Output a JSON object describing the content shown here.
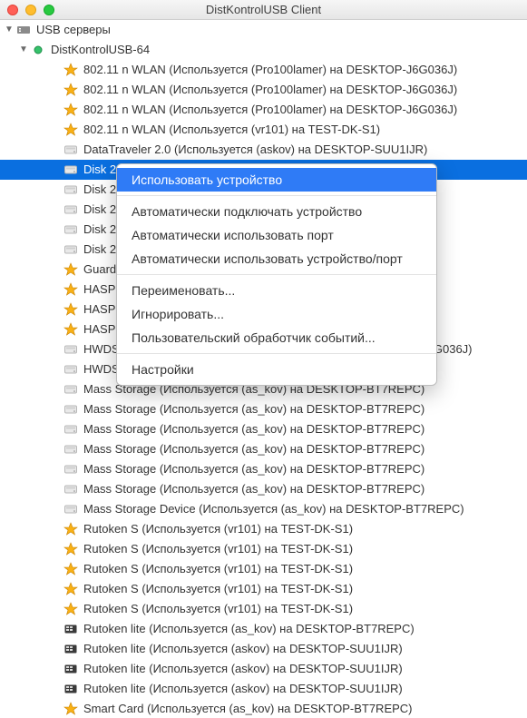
{
  "window": {
    "title": "DistKontrolUSB Client"
  },
  "tree": [
    {
      "depth": 0,
      "icon": "usb",
      "arrow": "down",
      "label": "USB серверы"
    },
    {
      "depth": 1,
      "icon": "dot-green",
      "arrow": "down",
      "label": "DistKontrolUSB-64"
    },
    {
      "depth": 2,
      "icon": "star",
      "label": "802.11 n WLAN (Используется  (Pro100lamer) на DESKTOP-J6G036J)"
    },
    {
      "depth": 2,
      "icon": "star",
      "label": "802.11 n WLAN (Используется  (Pro100lamer) на DESKTOP-J6G036J)"
    },
    {
      "depth": 2,
      "icon": "star",
      "label": "802.11 n WLAN (Используется  (Pro100lamer) на DESKTOP-J6G036J)"
    },
    {
      "depth": 2,
      "icon": "star",
      "label": "802.11 n WLAN (Используется  (vr101) на TEST-DK-S1)"
    },
    {
      "depth": 2,
      "icon": "drive",
      "label": "DataTraveler 2.0 (Используется  (askov) на DESKTOP-SUU1IJR)"
    },
    {
      "depth": 2,
      "icon": "drive",
      "label": "Disk 2.0",
      "selected": true
    },
    {
      "depth": 2,
      "icon": "drive",
      "label": "Disk 2.0"
    },
    {
      "depth": 2,
      "icon": "drive",
      "label": "Disk 2.0"
    },
    {
      "depth": 2,
      "icon": "drive",
      "label": "Disk 2.0"
    },
    {
      "depth": 2,
      "icon": "drive",
      "label": "Disk 2.0"
    },
    {
      "depth": 2,
      "icon": "star",
      "label": "Guarda                                                               EPC)"
    },
    {
      "depth": 2,
      "icon": "star",
      "label": "HASP 2                                                               .)"
    },
    {
      "depth": 2,
      "icon": "star",
      "label": "HASP 2"
    },
    {
      "depth": 2,
      "icon": "star",
      "label": "HASP H"
    },
    {
      "depth": 2,
      "icon": "drive",
      "label": "HWDSSL DEVICE (Используется  (Pro100lamer) на DESKTOP-J6G036J)"
    },
    {
      "depth": 2,
      "icon": "drive",
      "label": "HWDSSL DEVICE (Используется  (vr101) на TEST-DK-S1)"
    },
    {
      "depth": 2,
      "icon": "drive",
      "label": "Mass Storage (Используется  (as_kov) на DESKTOP-BT7REPC)"
    },
    {
      "depth": 2,
      "icon": "drive",
      "label": "Mass Storage (Используется  (as_kov) на DESKTOP-BT7REPC)"
    },
    {
      "depth": 2,
      "icon": "drive",
      "label": "Mass Storage (Используется  (as_kov) на DESKTOP-BT7REPC)"
    },
    {
      "depth": 2,
      "icon": "drive",
      "label": "Mass Storage (Используется  (as_kov) на DESKTOP-BT7REPC)"
    },
    {
      "depth": 2,
      "icon": "drive",
      "label": "Mass Storage (Используется  (as_kov) на DESKTOP-BT7REPC)"
    },
    {
      "depth": 2,
      "icon": "drive",
      "label": "Mass Storage (Используется  (as_kov) на DESKTOP-BT7REPC)"
    },
    {
      "depth": 2,
      "icon": "drive",
      "label": "Mass Storage Device (Используется  (as_kov) на DESKTOP-BT7REPC)"
    },
    {
      "depth": 2,
      "icon": "star",
      "label": "Rutoken S (Используется  (vr101) на TEST-DK-S1)"
    },
    {
      "depth": 2,
      "icon": "star",
      "label": "Rutoken S (Используется  (vr101) на TEST-DK-S1)"
    },
    {
      "depth": 2,
      "icon": "star",
      "label": "Rutoken S (Используется  (vr101) на TEST-DK-S1)"
    },
    {
      "depth": 2,
      "icon": "star",
      "label": "Rutoken S (Используется  (vr101) на TEST-DK-S1)"
    },
    {
      "depth": 2,
      "icon": "star",
      "label": "Rutoken S (Используется  (vr101) на TEST-DK-S1)"
    },
    {
      "depth": 2,
      "icon": "card",
      "label": "Rutoken lite (Используется  (as_kov) на DESKTOP-BT7REPC)"
    },
    {
      "depth": 2,
      "icon": "card",
      "label": "Rutoken lite (Используется  (askov) на DESKTOP-SUU1IJR)"
    },
    {
      "depth": 2,
      "icon": "card",
      "label": "Rutoken lite (Используется  (askov) на DESKTOP-SUU1IJR)"
    },
    {
      "depth": 2,
      "icon": "card",
      "label": "Rutoken lite (Используется  (askov) на DESKTOP-SUU1IJR)"
    },
    {
      "depth": 2,
      "icon": "star",
      "label": "Smart Card (Используется  (as_kov) на DESKTOP-BT7REPC)"
    }
  ],
  "menu": [
    {
      "type": "item",
      "label": "Использовать устройство",
      "highlight": true
    },
    {
      "type": "sep"
    },
    {
      "type": "item",
      "label": "Автоматически подключать устройство"
    },
    {
      "type": "item",
      "label": "Автоматически использовать порт"
    },
    {
      "type": "item",
      "label": "Автоматически использовать устройство/порт"
    },
    {
      "type": "sep"
    },
    {
      "type": "item",
      "label": "Переименовать..."
    },
    {
      "type": "item",
      "label": "Игнорировать..."
    },
    {
      "type": "item",
      "label": "Пользовательский обработчик событий..."
    },
    {
      "type": "sep"
    },
    {
      "type": "item",
      "label": "Настройки"
    }
  ]
}
